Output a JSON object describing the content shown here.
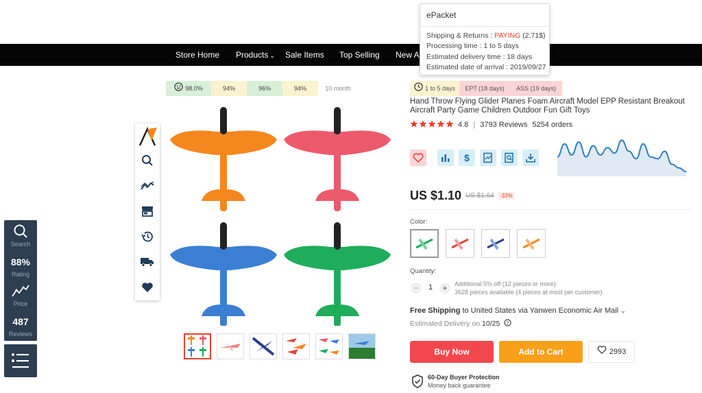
{
  "nav": {
    "items": [
      "Store Home",
      "Products",
      "Sale Items",
      "Top Selling",
      "New Ar"
    ]
  },
  "tooltip": {
    "title": "ePacket",
    "shipping_label": "Shipping & Returns : ",
    "shipping_status": "PAYING",
    "shipping_cost": " (2.71$)",
    "processing": "Processing time : 1 to 5 days",
    "delivery": "Estimated delivery time : 18 days",
    "arrival": "Estimated date of arrival : 2019/09/27"
  },
  "stats": {
    "values": [
      "98.0%",
      "94%",
      "96%",
      "94%",
      "10 month"
    ],
    "colors": [
      "#d8efd8",
      "#fbf2cf",
      "#d8efd8",
      "#fbf2cf",
      "#ffffff"
    ]
  },
  "left_widget": {
    "search_label": "Search",
    "rating_value": "88%",
    "rating_label": "Rating",
    "price_label": "Price",
    "reviews_value": "487",
    "reviews_label": "Reviews"
  },
  "shipping_badges": {
    "days": "1 to 5 days",
    "ept": "EPT (18 days)",
    "ass": "ASS (19 days)"
  },
  "product": {
    "title": "Hand Throw Flying Glider Planes Foam Aircraft Model EPP Resistant Breakout Aircraft Party Game Children Outdoor Fun Gift Toys",
    "rating": "4.8",
    "reviews": "3793 Reviews",
    "orders": "5254 orders",
    "price": "US $1.10",
    "old_price": "US $1.64",
    "discount": "-33%",
    "color_label": "Color:",
    "quantity_label": "Quantity:",
    "quantity": "1",
    "additional": "Additional 5% off (12 pieces or more)",
    "available": "3628 pieces available (4 pieces at most per customer)",
    "free_shipping": "Free Shipping",
    "shipping_dest": " to United States via Yanwen Economic Air Mail",
    "est_delivery_label": "Estimated Delivery on ",
    "est_delivery_date": "10/25",
    "buy_now": "Buy Now",
    "add_to_cart": "Add to Cart",
    "wishlist_count": "2993",
    "protection_title": "60-Day Buyer Protection",
    "protection_sub": "Money back guarantee"
  },
  "price_trend": [
    0.55,
    0.2,
    0.5,
    0.15,
    0.55,
    0.25,
    0.5,
    0.3,
    0.45,
    0.1,
    0.4,
    0.6,
    0.2,
    0.55,
    0.6,
    0.4,
    0.75,
    0.85,
    0.95
  ],
  "plane_colors": {
    "orange": "#f5871f",
    "pink": "#ec5a6c",
    "blue": "#3a7fd4",
    "green": "#1fad5c"
  }
}
